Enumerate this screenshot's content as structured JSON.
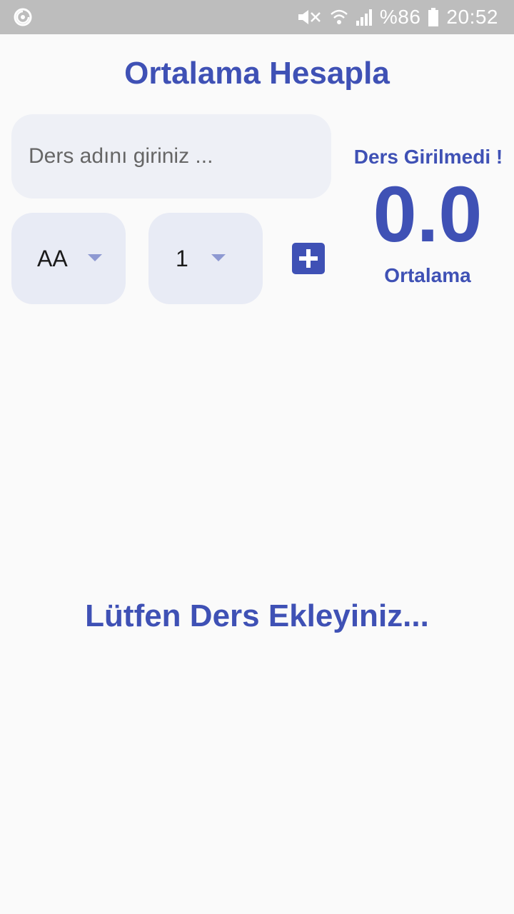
{
  "status_bar": {
    "battery_percent": "%86",
    "time": "20:52",
    "icons": [
      "sync-icon",
      "mute-icon",
      "wifi-icon",
      "signal-icon",
      "battery-icon"
    ]
  },
  "title": "Ortalama Hesapla",
  "course_input": {
    "placeholder": "Ders adını giriniz ...",
    "value": ""
  },
  "grade_dropdown": {
    "selected": "AA"
  },
  "credit_dropdown": {
    "selected": "1"
  },
  "add_button": {
    "icon": "add-box-icon"
  },
  "result": {
    "status_message": "Ders Girilmedi !",
    "average": "0.0",
    "average_label": "Ortalama"
  },
  "empty_message": "Lütfen Ders Ekleyiniz...",
  "colors": {
    "primary": "#3f51b5",
    "background": "#fafafa",
    "field_background": "#eef0f6",
    "status_bar": "#bdbdbd"
  }
}
